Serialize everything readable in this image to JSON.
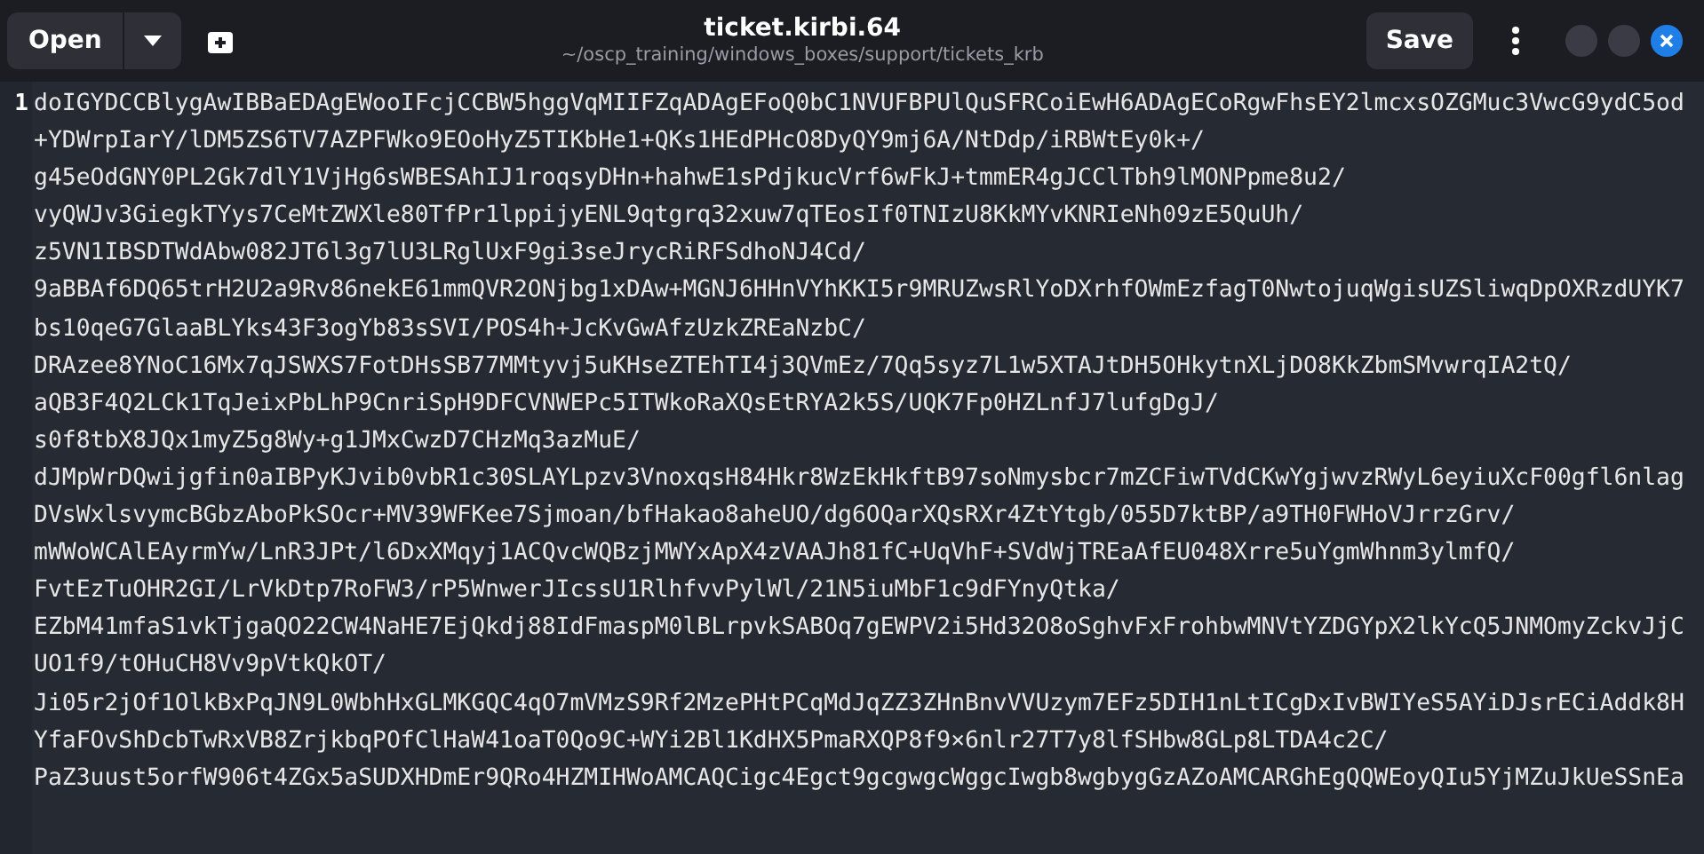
{
  "header": {
    "open_button": "Open",
    "title": "ticket.kirbi.64",
    "path": "~/oscp_training/windows_boxes/support/tickets_krb",
    "save_button": "Save"
  },
  "editor": {
    "line_number": "1",
    "lines": [
      "doIGYDCCBlygAwIBBaEDAgEWooIFcjCCBW5hggVqMIIFZqADAgEFoQ0bC1NVUFBPUlQuSFRCoiEwH6ADAgECoRgwFhsEY2lmcxsOZGMuc3VwcG9ydC5od",
      "+YDWrpIarY/lDM5ZS6TV7AZPFWko9EOoHyZ5TIKbHe1+QKs1HEdPHcO8DyQY9mj6A/NtDdp/iRBWtEy0k+/",
      "g45eOdGNY0PL2Gk7dlY1VjHg6sWBESAhIJ1roqsyDHn+hahwE1sPdjkucVrf6wFkJ+tmmER4gJCClTbh9lMONPpme8u2/",
      "vyQWJv3GiegkTYys7CeMtZWXle80TfPr1lppijyENL9qtgrq32xuw7qTEosIf0TNIzU8KkMYvKNRIeNh09zE5QuUh/",
      "z5VN1IBSDTWdAbw082JT6l3g7lU3LRglUxF9gi3seJrycRiRFSdhoNJ4Cd/",
      "9aBBAf6DQ65trH2U2a9Rv86nekE61mmQVR2ONjbg1xDAw+MGNJ6HHnVYhKKI5r9MRUZwsRlYoDXrhfOWmEzfagT0NwtojuqWgisUZSliwqDpOXRzdUYK7",
      "bs10qeG7GlaaBLYks43F3ogYb83sSVI/POS4h+JcKvGwAfzUzkZREaNzbC/",
      "DRAzee8YNoC16Mx7qJSWXS7FotDHsSB77MMtyvj5uKHseZTEhTI4j3QVmEz/7Qq5syz7L1w5XTAJtDH5OHkytnXLjDO8KkZbmSMvwrqIA2tQ/",
      "aQB3F4Q2LCk1TqJeixPbLhP9CnriSpH9DFCVNWEPc5ITWkoRaXQsEtRYA2k5S/UQK7Fp0HZLnfJ7lufgDgJ/",
      "s0f8tbX8JQx1myZ5g8Wy+g1JMxCwzD7CHzMq3azMuE/",
      "dJMpWrDQwijgfin0aIBPyKJvib0vbR1c30SLAYLpzv3VnoxqsH84Hkr8WzEkHkftB97soNmysbcr7mZCFiwTVdCKwYgjwvzRWyL6eyiuXcF00gfl6nlag",
      "DVsWxlsvymcBGbzAboPkSOcr+MV39WFKee7Sjmoan/bfHakao8aheUO/dg6OQarXQsRXr4ZtYtgb/055D7ktBP/a9TH0FWHoVJrrzGrv/",
      "mWWoWCAlEAyrmYw/LnR3JPt/l6DxXMqyj1ACQvcWQBzjMWYxApX4zVAAJh81fC+UqVhF+SVdWjTREaAfEU048Xrre5uYgmWhnm3ylmfQ/",
      "FvtEzTuOHR2GI/LrVkDtp7RoFW3/rP5WnwerJIcssU1RlhfvvPylWl/21N5iuMbF1c9dFYnyQtka/",
      "EZbM41mfaS1vkTjgaQO22CW4NaHE7EjQkdj88IdFmaspM0lBLrpvkSABOq7gEWPV2i5Hd32O8oSghvFxFrohbwMNVtYZDGYpX2lkYcQ5JNMOmyZckvJjC",
      "UO1f9/tOHuCH8Vv9pVtkQkOT/",
      "Ji05r2jOf1OlkBxPqJN9L0WbhHxGLMKGQC4qO7mVMzS9Rf2MzePHtPCqMdJqZZ3ZHnBnvVVUzym7EFz5DIH1nLtICgDxIvBWIYeS5AYiDJsrECiAddk8H",
      "YfaFOvShDcbTwRxVB8ZrjkbqPOfClHaW41oaT0Qo9C+WYi2Bl1KdHX5PmaRXQP8f9×6nlr27T7y8lfSHbw8GLp8LTDA4c2C/",
      "PaZ3uust5orfW906t4ZGx5aSUDXHDmEr9QRo4HZMIHWoAMCAQCigc4Egct9gcgwgcWggcIwgb8wgbygGzAZoAMCARGhEgQQWEoyQIu5YjMZuJkUeSSnEa"
    ]
  }
}
